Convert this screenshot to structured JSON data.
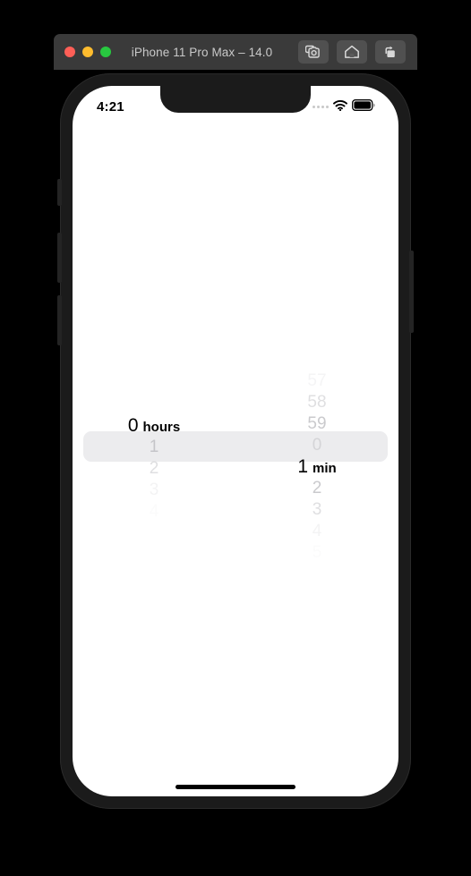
{
  "window": {
    "title": "iPhone 11 Pro Max – 14.0",
    "traffic_lights": [
      {
        "name": "close",
        "color": "#ff5f57"
      },
      {
        "name": "minimize",
        "color": "#febc2e"
      },
      {
        "name": "maximize",
        "color": "#28c840"
      }
    ],
    "toolbar": [
      {
        "name": "screenshot-icon",
        "label": "Screenshot"
      },
      {
        "name": "home-icon",
        "label": "Home"
      },
      {
        "name": "rotate-icon",
        "label": "Rotate"
      }
    ],
    "titlebar_color": "#3a3a3a",
    "button_color": "#505050"
  },
  "status_bar": {
    "time": "4:21",
    "cellular_dots": 4,
    "wifi_icon": "wifi-icon",
    "battery_icon": "battery-full-icon"
  },
  "picker": {
    "selection_bar_color": "#ececee",
    "columns": [
      {
        "name": "hours",
        "unit": "hours",
        "selected_value": "0",
        "rows_above": [],
        "rows_below": [
          "1",
          "2",
          "3",
          "4"
        ]
      },
      {
        "name": "minutes",
        "unit": "min",
        "selected_value": "1",
        "rows_above": [
          "57",
          "58",
          "59",
          "0"
        ],
        "rows_below": [
          "2",
          "3",
          "4",
          "5"
        ]
      }
    ]
  },
  "home_indicator": "home-indicator"
}
